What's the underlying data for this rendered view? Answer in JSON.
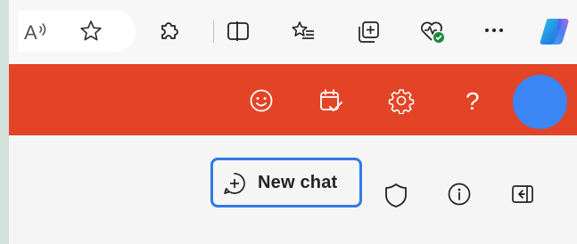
{
  "toolbar": {
    "icons": [
      "read-aloud-icon",
      "favorite-star-icon",
      "extensions-puzzle-icon",
      "split-screen-icon",
      "favorites-list-icon",
      "collections-icon",
      "browser-essentials-icon",
      "more-options-icon",
      "copilot-icon"
    ],
    "read_aloud_glyph": "A",
    "more_glyph": "···"
  },
  "header": {
    "background": "#e34425",
    "icons": [
      "feedback-smiley-icon",
      "calendar-check-icon",
      "settings-gear-icon",
      "help-icon"
    ],
    "help_glyph": "?",
    "avatar_color": "#3c86f5"
  },
  "content": {
    "new_chat_label": "New chat",
    "focus_ring_color": "#2f7be5",
    "icons": [
      "shield-icon",
      "info-icon",
      "collapse-panel-icon"
    ]
  }
}
